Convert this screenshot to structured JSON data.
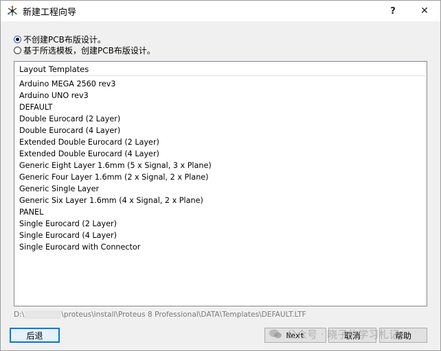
{
  "window": {
    "title": "新建工程向导",
    "help_glyph": "?",
    "close_glyph": "✕"
  },
  "options": {
    "radio1_label": "不创建PCB布版设计。",
    "radio1_checked": true,
    "radio2_label": "基于所选模板，创建PCB布版设计。",
    "radio2_checked": false
  },
  "list": {
    "header": "Layout Templates",
    "items": [
      "Arduino MEGA 2560 rev3",
      "Arduino UNO rev3",
      "DEFAULT",
      "Double Eurocard (2 Layer)",
      "Double Eurocard (4 Layer)",
      "Extended Double Eurocard (2 Layer)",
      "Extended Double Eurocard (4 Layer)",
      "Generic Eight Layer 1.6mm (5 x Signal, 3 x Plane)",
      "Generic Four Layer 1.6mm (2 x Signal, 2 x Plane)",
      "Generic Single Layer",
      "Generic Six Layer 1.6mm (4 x Signal, 2 x Plane)",
      "PANEL",
      "Single Eurocard (2 Layer)",
      "Single Eurocard (4 Layer)",
      "Single Eurocard with Connector"
    ]
  },
  "status": {
    "path_prefix": "D:\\",
    "path_suffix": "\\proteus\\install\\Proteus 8 Professional\\DATA\\Templates\\DEFAULT.LTF"
  },
  "buttons": {
    "back": "后退",
    "next": "Next",
    "cancel": "取消",
    "help": "帮助"
  },
  "watermark": {
    "text": "公众号 · 晓子的学习札记"
  },
  "colors": {
    "accent": "#0078d7",
    "window_bg": "#f0f0f0"
  }
}
